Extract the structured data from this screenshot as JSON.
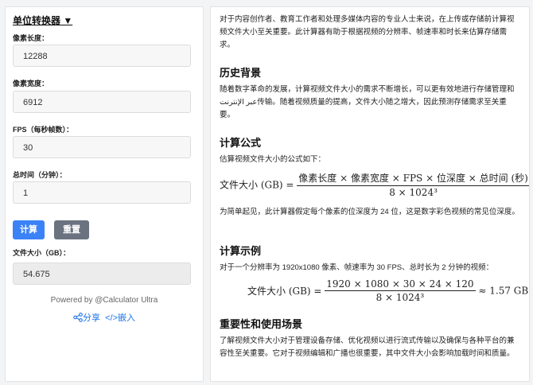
{
  "left": {
    "unit_converter": "单位转换器 ▼",
    "fields": [
      {
        "label": "像素长度：",
        "value": "12288"
      },
      {
        "label": "像素宽度：",
        "value": "6912"
      },
      {
        "label": "FPS（每秒帧数）：",
        "value": "30"
      },
      {
        "label": "总时间（分钟）：",
        "value": "1"
      }
    ],
    "calc_button": "计算",
    "reset_button": "重置",
    "result_label": "文件大小（GB）：",
    "result_value": "54.675",
    "powered_by": "Powered by @Calculator Ultra",
    "share": "分享",
    "embed": "</>嵌入"
  },
  "right": {
    "intro": "对于内容创作者、教育工作者和处理多媒体内容的专业人士来说，在上传或存储前计算视频文件大小至关重要。此计算器有助于根据视频的分辨率、帧速率和时长来估算存储需求。",
    "history_heading": "历史背景",
    "history_text": "随着数字革命的发展，计算视频文件大小的需求不断增长，可以更有效地进行存储管理和 عبر الإنترنت传输。随着视频质量的提高，文件大小随之增大，因此预测存储需求至关重要。",
    "formula_heading": "计算公式",
    "formula_intro": "估算视频文件大小的公式如下：",
    "formula_lhs": "文件大小 (GB) =",
    "formula_num": "像素长度 × 像素宽度 × FPS × 位深度 × 总时间 (秒)",
    "formula_den": "8 × 1024³",
    "formula_note": "为简单起见，此计算器假定每个像素的位深度为 24 位，这是数字彩色视频的常见位深度。",
    "example_heading": "计算示例",
    "example_intro": "对于一个分辨率为 1920x1080 像素、帧速率为 30 FPS、总时长为 2 分钟的视频：",
    "example_lhs": "文件大小 (GB) =",
    "example_num": "1920 × 1080 × 30 × 24 × 120",
    "example_den": "8 × 1024³",
    "example_result": "≈ 1.57 GB",
    "importance_heading": "重要性和使用场景",
    "importance_text": "了解视频文件大小对于管理设备存储、优化视频以进行流式传输以及确保与各种平台的兼容性至关重要。它对于视频编辑和广播也很重要，其中文件大小会影响加载时间和质量。"
  }
}
